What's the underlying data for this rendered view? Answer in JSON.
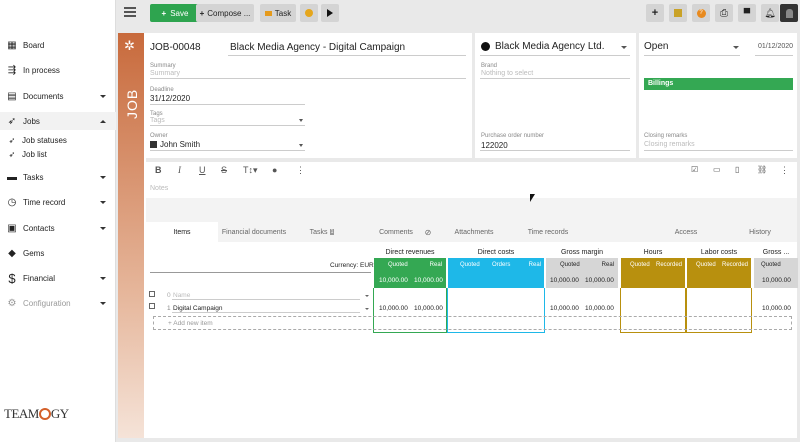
{
  "toolbar": {
    "save_label": "Save",
    "compose_label": "Compose ...",
    "task_label": "Task"
  },
  "sidebar": {
    "items": [
      {
        "label": "Board",
        "icon": "grid-icon"
      },
      {
        "label": "In process",
        "icon": "flow-icon"
      },
      {
        "label": "Documents",
        "icon": "document-icon"
      },
      {
        "label": "Jobs",
        "icon": "rocket-icon"
      },
      {
        "label": "Job statuses",
        "icon": "rocket-icon"
      },
      {
        "label": "Job list",
        "icon": "rocket-icon"
      },
      {
        "label": "Tasks",
        "icon": "tasks-icon"
      },
      {
        "label": "Time record",
        "icon": "clock-icon"
      },
      {
        "label": "Contacts",
        "icon": "contacts-icon"
      },
      {
        "label": "Gems",
        "icon": "gem-icon"
      },
      {
        "label": "Financial",
        "icon": "dollar-icon"
      },
      {
        "label": "Configuration",
        "icon": "gear-icon"
      }
    ],
    "logo": "TEAMGY"
  },
  "job": {
    "side_label": "JOB",
    "number": "JOB-00048",
    "title": "Black Media Agency - Digital Campaign",
    "summary_label": "Summary",
    "summary_placeholder": "Summary",
    "deadline_label": "Deadline",
    "deadline": "31/12/2020",
    "tags_label": "Tags",
    "tags_placeholder": "Tags",
    "owner_label": "Owner",
    "owner": "John Smith",
    "company": "Black Media Agency Ltd.",
    "brand_label": "Brand",
    "brand_placeholder": "Nothing to select",
    "po_label": "Purchase order number",
    "po": "122020",
    "status": "Open",
    "status_date": "01/12/2020",
    "billings_label": "Billings",
    "closing_label": "Closing remarks",
    "closing_placeholder": "Closing remarks",
    "notes_placeholder": "Notes",
    "editor_buttons": [
      "B",
      "I",
      "U",
      "S",
      "TT",
      "⬤",
      "⋮"
    ]
  },
  "tabs": [
    "Items",
    "Financial documents",
    "Tasks",
    "Comments",
    "Attachments",
    "Time records",
    "Access",
    "History"
  ],
  "tasks_badge": "1",
  "table": {
    "currency": "Currency: EUR",
    "groups": {
      "direct_revenues": "Direct revenues",
      "direct_costs": "Direct costs",
      "gross_margin": "Gross margin",
      "hours": "Hours",
      "labor_costs": "Labor costs",
      "gross": "Gross ..."
    },
    "sub": {
      "quoted": "Quoted",
      "real": "Real",
      "orders": "Orders",
      "recorded": "Recorded"
    },
    "totals": {
      "rev_quoted": "10,000.00",
      "rev_real": "10,000.00",
      "gm_quoted": "10,000.00",
      "gm_real": "10,000.00",
      "gross": "10,000.00"
    },
    "rows": [
      {
        "index": "0",
        "name_placeholder": "Name"
      },
      {
        "index": "1",
        "name": "Digital Campaign",
        "rev_quoted": "10,000.00",
        "rev_real": "10,000.00",
        "gm_quoted": "10,000.00",
        "gm_real": "10,000.00",
        "gross": "10,000.00"
      }
    ],
    "add_item": "+ Add new item"
  },
  "colors": {
    "save": "#2ea44f",
    "revenue": "#34a853",
    "costs": "#1eb8e8",
    "hours": "#b8900e",
    "labor": "#b8900e",
    "gross_margin": "#d6d6d6",
    "billings": "#34a853",
    "job_strip": "#c86a3c"
  }
}
